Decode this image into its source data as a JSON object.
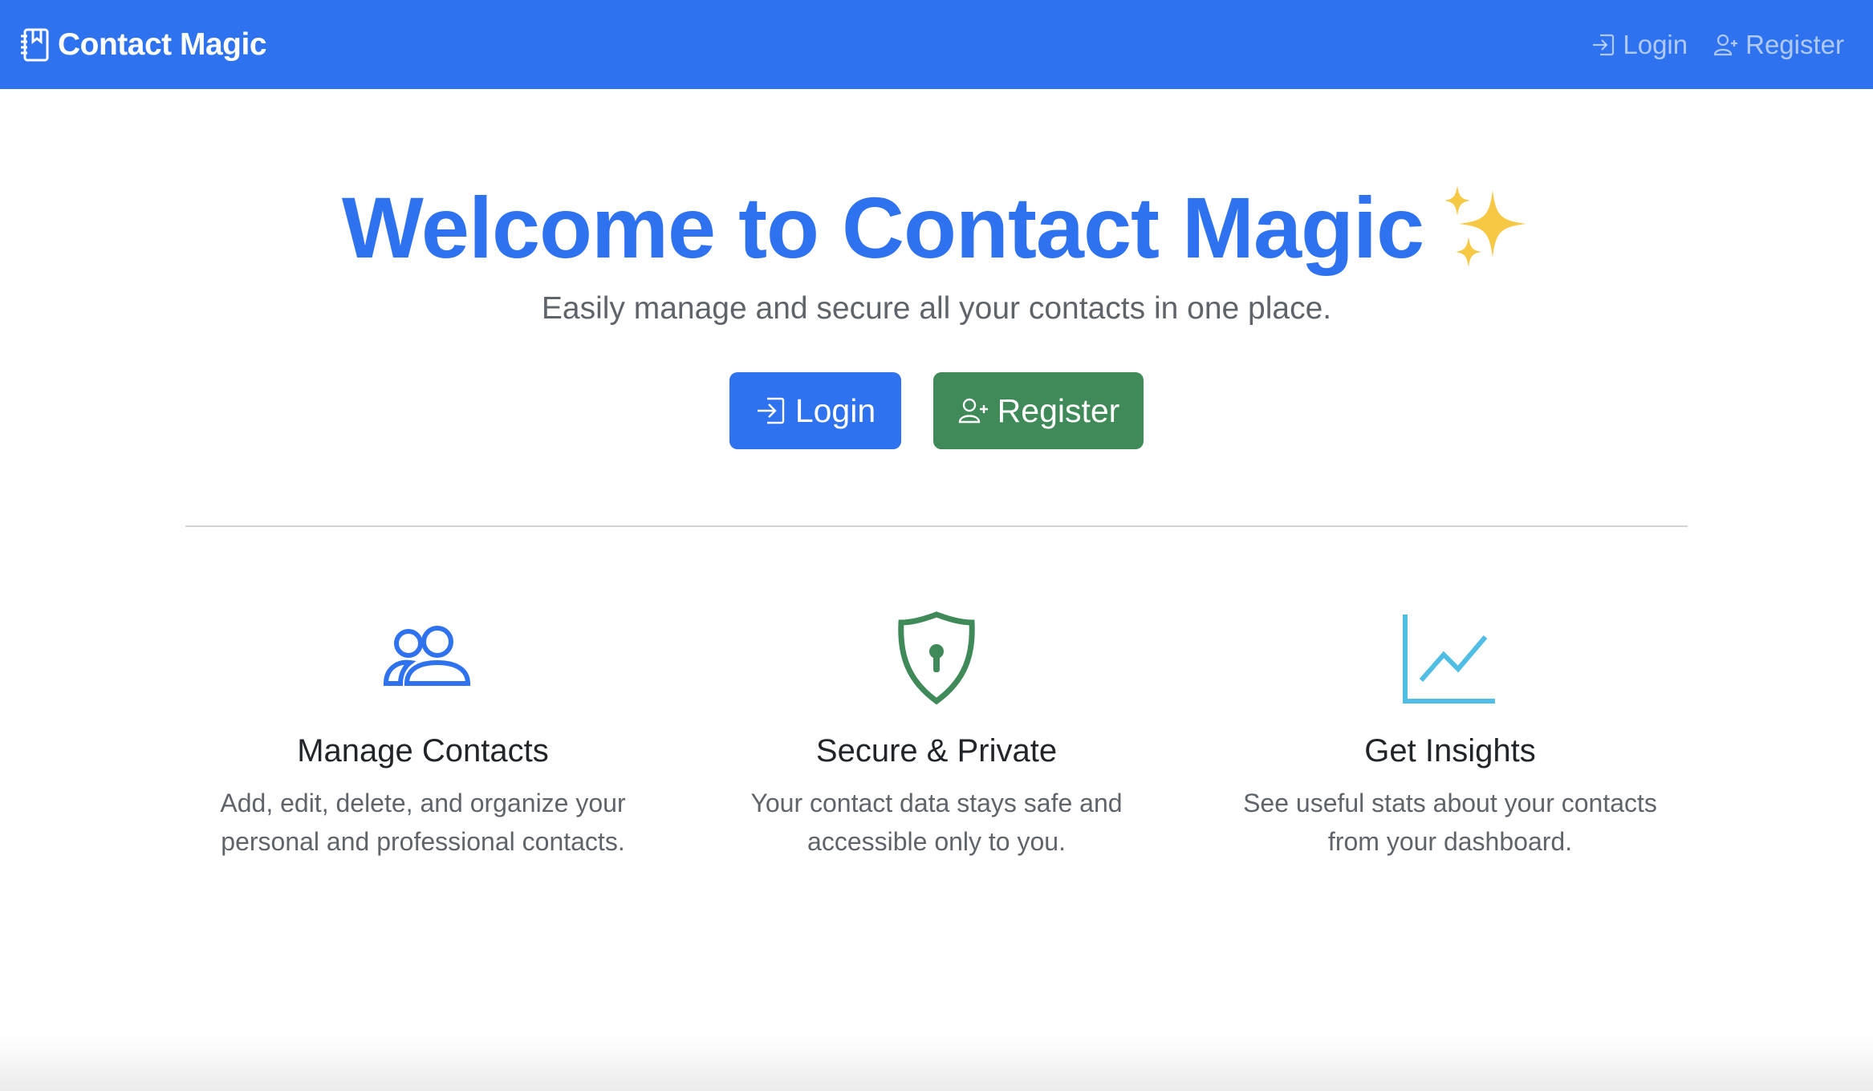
{
  "navbar": {
    "brand": "Contact Magic",
    "links": [
      {
        "label": "Login",
        "icon": "login-icon"
      },
      {
        "label": "Register",
        "icon": "person-add-icon"
      }
    ],
    "background": "#2f72ef"
  },
  "hero": {
    "title": "Welcome to Contact Magic",
    "title_emoji": "sparkles",
    "subtitle": "Easily manage and secure all your contacts in one place.",
    "login_label": "Login",
    "register_label": "Register",
    "login_color": "#2f72ef",
    "register_color": "#3f8a58"
  },
  "features": [
    {
      "icon": "people-icon",
      "title": "Manage Contacts",
      "desc_line1": "Add, edit, delete, and organize your",
      "desc_line2": "personal and professional contacts.",
      "color": "#2f72ef"
    },
    {
      "icon": "shield-lock-icon",
      "title": "Secure & Private",
      "desc_line1": "Your contact data stays safe and",
      "desc_line2": "accessible only to you.",
      "color": "#3f8a58"
    },
    {
      "icon": "graph-up-icon",
      "title": "Get Insights",
      "desc_line1": "See useful stats about your contacts",
      "desc_line2": "from your dashboard.",
      "color": "#4fbde4"
    }
  ]
}
